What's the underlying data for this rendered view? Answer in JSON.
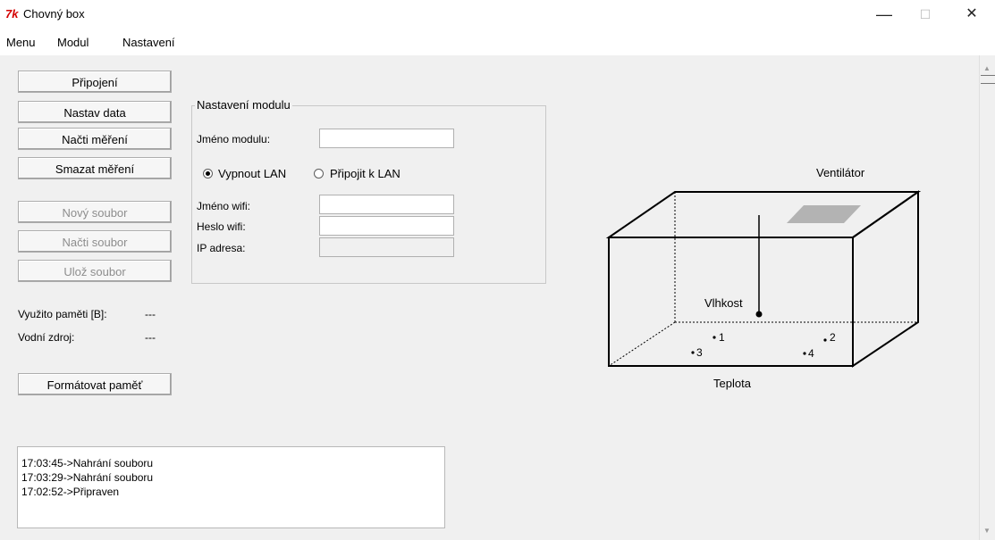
{
  "window": {
    "title": "Chovný box",
    "icon": "tk-feather-icon",
    "minimize": "—",
    "maximize": "☐",
    "close": "✕"
  },
  "menu": [
    "Menu",
    "Modul",
    "Nastavení"
  ],
  "buttons": {
    "connect": "Připojení",
    "set_data": "Nastav data",
    "load_measure": "Načti měření",
    "delete_measure": "Smazat měření",
    "new_file": "Nový soubor",
    "load_file": "Načti soubor",
    "save_file": "Ulož soubor",
    "format": "Formátovat paměť"
  },
  "status": {
    "memory_label": "Využito paměti [B]:",
    "memory_value": "---",
    "water_label": "Vodní zdroj:",
    "water_value": "---"
  },
  "module": {
    "title": "Nastavení modulu",
    "name_label": "Jméno modulu:",
    "name_value": "",
    "radio_off": "Vypnout LAN",
    "radio_on": "Připojit k LAN",
    "selected": "Vypnout LAN",
    "wifi_name_label": "Jméno wifi:",
    "wifi_name_value": "",
    "wifi_pass_label": "Heslo wifi:",
    "wifi_pass_value": "",
    "ip_label": "IP adresa:",
    "ip_value": ""
  },
  "log": [
    "17:03:45->Nahrání souboru",
    "17:03:29->Nahrání souboru",
    "17:02:52->Připraven"
  ],
  "diagram": {
    "fan": "Ventilátor",
    "humidity": "Vlhkost",
    "temperature": "Teplota",
    "sensors": [
      "1",
      "2",
      "3",
      "4"
    ]
  },
  "colors": {
    "app_icon": "#d40000",
    "fan_plate": "#b3b3b3"
  }
}
